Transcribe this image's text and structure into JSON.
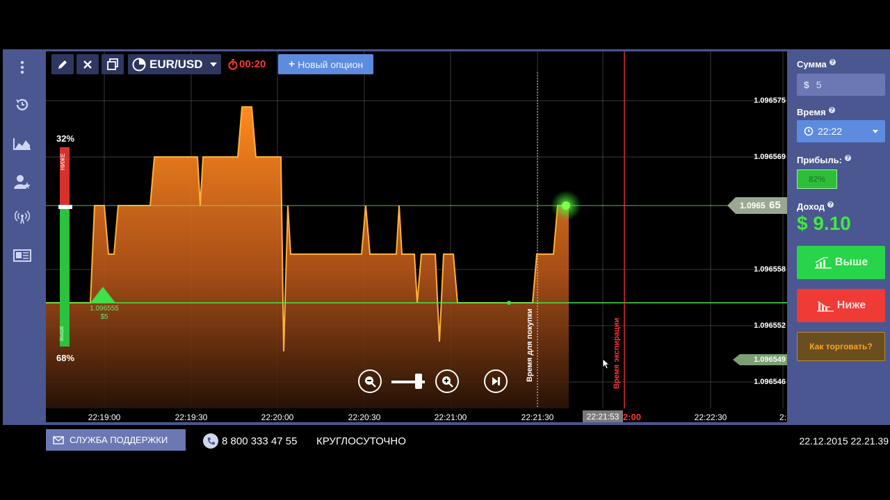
{
  "toolbar": {
    "pair": "EUR/USD",
    "timer": "00:20",
    "new_option": "Новый опцион"
  },
  "sentiment": {
    "top_pct": "32%",
    "bottom_pct": "68%",
    "lower_label": "НИЖЕ",
    "higher_label": "ВЫШЕ"
  },
  "entry": {
    "price": "1.096555",
    "amount": "$5"
  },
  "price_axis": [
    "1.096575",
    "1.096569",
    "1.096558",
    "1.096552",
    "1.096549",
    "1.096546"
  ],
  "current_price": {
    "prefix": "1.0965",
    "suffix": "65"
  },
  "vertical_labels": {
    "purchase": "Время для покупки",
    "expiry": "Время экспирации"
  },
  "time_axis": [
    "22:19:00",
    "22:19:30",
    "22:20:00",
    "22:20:30",
    "22:21:00",
    "22:21:30",
    "22:22:30",
    "2:"
  ],
  "current_time_badge": "22:21:53",
  "expiry_time_badge": "2:00",
  "panel": {
    "amount_label": "Сумма",
    "amount_currency": "$",
    "amount_value": "5",
    "time_label": "Время",
    "time_value": "22:22",
    "profit_label": "Прибыль:",
    "profit_value": "82%",
    "income_label": "Доход",
    "income_value": "$ 9.10",
    "up_button": "Выше",
    "down_button": "Ниже",
    "how_button": "Как торговать?"
  },
  "footer": {
    "support": "СЛУЖБА ПОДДЕРЖКИ",
    "phone": "8 800 333 47 55",
    "hours": "КРУГЛОСУТОЧНО",
    "datetime": "22.12.2015 22.21.39"
  },
  "colors": {
    "accent_green": "#28d44a",
    "accent_red": "#ef3a36",
    "area_orange": "#f57b1c",
    "panel_blue": "#4a5790"
  }
}
